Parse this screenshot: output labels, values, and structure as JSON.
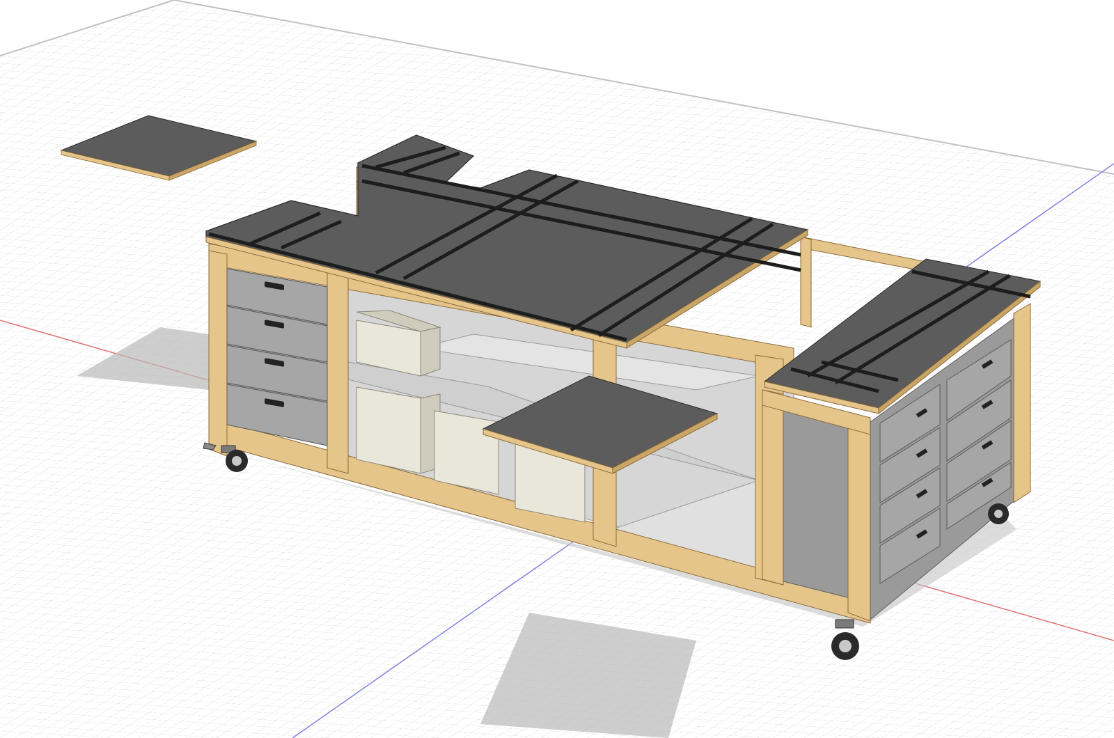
{
  "viewport": {
    "background": "#ffffff",
    "grid_color": "#d8d8d8",
    "grid_major_color": "#c6c6c6",
    "x_axis_color": "#e07070",
    "y_axis_color": "#8080e0"
  },
  "materials": {
    "wood": "#e6c58a",
    "wood_dark": "#c9a566",
    "wood_edge": "#8a6a3a",
    "top_surface": "#5c5c5c",
    "top_surface_dark": "#4a4a4a",
    "track": "#1d1d1d",
    "drawer_face": "#9a9a9a",
    "drawer_face_light": "#a9a9a9",
    "shelf": "#cfcfcf",
    "bin": "#e9e6da",
    "bin_shade": "#cfcbbd",
    "shadow": "#b9b9b9"
  },
  "model": {
    "parts": [
      "loose-top-panel",
      "main-table-top",
      "right-cabinet",
      "left-drawer-cabinet",
      "storage-bins",
      "pull-out-shelf",
      "casters"
    ]
  }
}
